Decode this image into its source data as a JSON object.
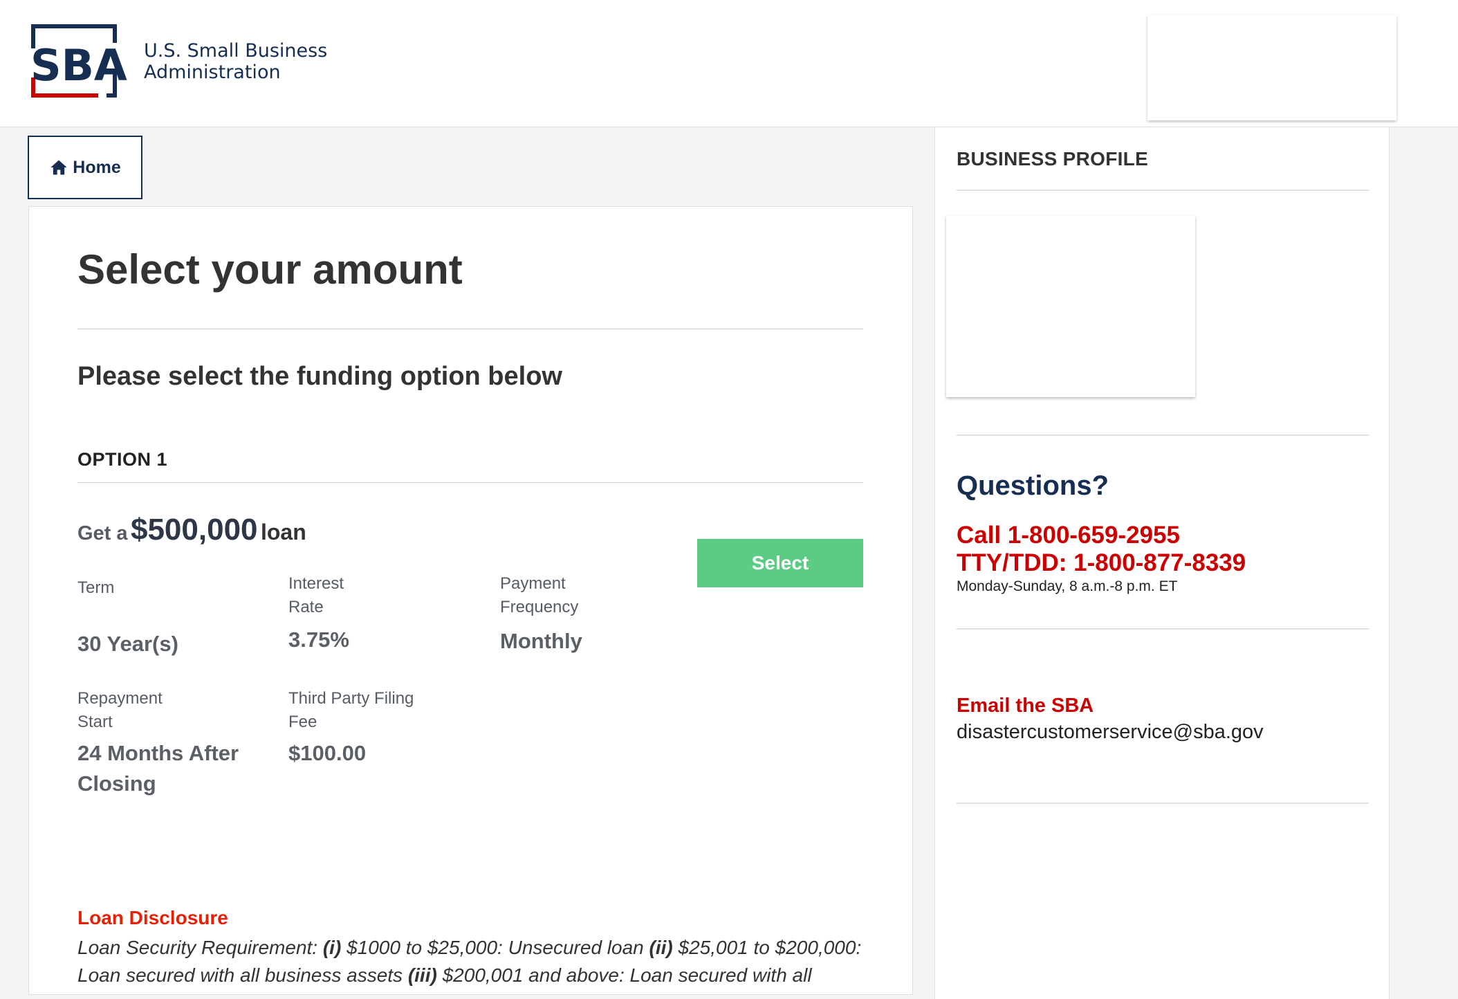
{
  "header": {
    "logo_abbr": "SBA",
    "agency_line1": "U.S. Small Business",
    "agency_line2": "Administration",
    "brand_navy": "#162e51",
    "brand_red": "#cc0000"
  },
  "nav": {
    "home_label": "Home",
    "home_icon": "house-icon"
  },
  "main": {
    "title": "Select your amount",
    "subtitle": "Please select the funding option below",
    "option_label": "OPTION 1",
    "loan_prefix": "Get a",
    "loan_amount": "$500,000",
    "loan_suffix": "loan",
    "select_label": "Select",
    "select_color": "#5ccb83",
    "fields": {
      "term_label": "Term",
      "term_value": "30 Year(s)",
      "rate_label_1": "Interest",
      "rate_label_2": "Rate",
      "rate_value": "3.75%",
      "freq_label_1": "Payment",
      "freq_label_2": "Frequency",
      "freq_value": "Monthly",
      "repay_label_1": "Repayment",
      "repay_label_2": "Start",
      "repay_value_1": "24 Months After",
      "repay_value_2": "Closing",
      "fee_label_1": "Third Party Filing",
      "fee_label_2": "Fee",
      "fee_value": "$100.00"
    },
    "disclosure": {
      "title": "Loan Disclosure",
      "part1": "Loan Security Requirement: ",
      "i": "(i)",
      "part2": " $1000 to $25,000: Unsecured loan ",
      "ii": "(ii)",
      "part3": " $25,001 to $200,000: Loan secured with all business assets ",
      "iii": "(iii)",
      "part4": " $200,001 and above: Loan secured with all"
    }
  },
  "sidebar": {
    "business_profile_title": "BUSINESS PROFILE",
    "questions_title": "Questions?",
    "call_line": "Call 1-800-659-2955",
    "tty_line": "TTY/TDD: 1-800-877-8339",
    "hours": "Monday-Sunday, 8 a.m.-8 p.m. ET",
    "email_title": "Email the SBA",
    "email_address": "disastercustomerservice@sba.gov"
  }
}
